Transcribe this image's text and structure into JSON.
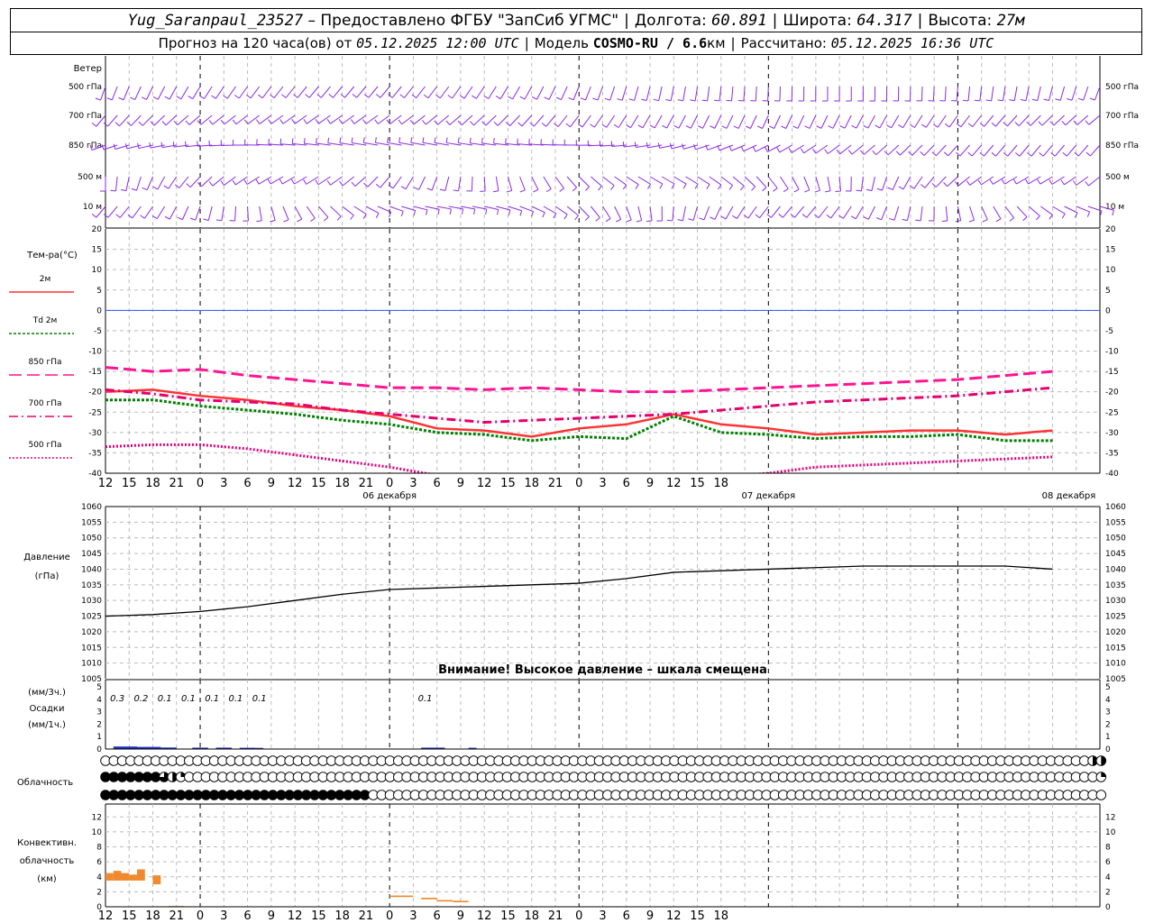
{
  "header": {
    "station": "Yug_Saranpaul_23527",
    "provider": "– Предоставлено ФГБУ \"ЗапСиб УГМС\"",
    "lon_label": "Долгота:",
    "lon": "60.891",
    "lat_label": "Широта:",
    "lat": "64.317",
    "alt_label": "Высота:",
    "alt": "27м",
    "forecast_label": "Прогноз на 120 часа(ов) от",
    "forecast_time": "05.12.2025 12:00 UTC",
    "model_label": "Модель",
    "model": "COSMO-RU / 6.6",
    "model_unit": "км",
    "calc_label": "Рассчитано:",
    "calc_time": "05.12.2025 16:36 UTC"
  },
  "colors": {
    "wind": "#8a2be2",
    "t2m": "#ff3333",
    "td2m": "#008000",
    "t850": "#ff1493",
    "t700": "#e6006e",
    "t500": "#e6007e",
    "zero": "#3050ff",
    "pressure": "#000000",
    "precip": "#2030c0",
    "conv": "#f08a30"
  },
  "wind_panel": {
    "title": "Ветер",
    "levels": [
      "500 гПа",
      "700 гПа",
      "850 гПа",
      "500 м",
      "10 м"
    ]
  },
  "temp_panel": {
    "title": "Тем-ра(°С)",
    "legend": [
      {
        "label": "2м",
        "color": "#ff3333",
        "dash": ""
      },
      {
        "label": "Td  2м",
        "color": "#008000",
        "dash": "3,2"
      },
      {
        "label": "850 гПа",
        "color": "#ff1493",
        "dash": "14,6"
      },
      {
        "label": "700 гПа",
        "color": "#e6006e",
        "dash": "10,4,2,4"
      },
      {
        "label": "500 гПа",
        "color": "#e6007e",
        "dash": "2,2"
      }
    ],
    "y_ticks": [
      "20",
      "15",
      "10",
      "5",
      "0",
      "-5",
      "-10",
      "-15",
      "-20",
      "-25",
      "-30",
      "-35",
      "-40"
    ]
  },
  "x_axis": {
    "hour_labels": [
      "12",
      "15",
      "18",
      "21",
      "0",
      "3",
      "6",
      "9",
      "12",
      "15",
      "18",
      "21",
      "0",
      "3",
      "6",
      "9",
      "12",
      "15",
      "18",
      "21",
      "0",
      "3",
      "6",
      "9",
      "12",
      "15",
      "18"
    ],
    "dates": [
      "06 декабря",
      "07 декабря",
      "08 декабря"
    ]
  },
  "pressure_panel": {
    "title": "Давление",
    "unit": "(гПа)",
    "y_ticks": [
      "1060",
      "1055",
      "1050",
      "1045",
      "1040",
      "1035",
      "1030",
      "1025",
      "1020",
      "1015",
      "1010",
      "1005"
    ],
    "warning": "Внимание! Высокое давление – шкала смещена"
  },
  "precip_panel": {
    "unit3": "(мм/3ч.)",
    "title": "Осадки",
    "unit1": "(мм/1ч.)",
    "y_ticks": [
      "5",
      "4",
      "3",
      "2",
      "1",
      "0"
    ],
    "amounts": [
      {
        "text": "0.3",
        "hour": 1.5
      },
      {
        "text": "0.2",
        "hour": 4.5
      },
      {
        "text": "0.1",
        "hour": 7.5
      },
      {
        "text": "0.1",
        "hour": 10.5
      },
      {
        "text": "0.1",
        "hour": 13.5
      },
      {
        "text": "0.1",
        "hour": 16.5
      },
      {
        "text": "0.1",
        "hour": 19.5
      },
      {
        "text": "0.1",
        "hour": 40.5
      }
    ]
  },
  "cloud_panel": {
    "title": "Облачность"
  },
  "conv_panel": {
    "title1": "Конвективн.",
    "title2": "облачность",
    "unit": "(км)",
    "y_ticks": [
      "12",
      "10",
      "8",
      "6",
      "4",
      "2",
      "0"
    ]
  },
  "chart_data": [
    {
      "type": "line",
      "title": "Тем-ра(°С)",
      "x_hours_from_start": [
        0,
        6,
        12,
        18,
        24,
        30,
        36,
        42,
        48,
        54,
        60,
        66,
        72,
        78,
        84,
        90,
        96,
        102,
        108,
        114,
        120
      ],
      "ylim": [
        -40,
        20
      ],
      "series": [
        {
          "name": "2м",
          "values": [
            -20,
            -19.5,
            -21,
            -22,
            -23.5,
            -24.5,
            -26,
            -29,
            -29.5,
            -31,
            -29,
            -28,
            -25.5,
            -28,
            -29,
            -30.5,
            -30,
            -29.5,
            -29.5,
            -30.5,
            -29.5
          ]
        },
        {
          "name": "Td  2м",
          "values": [
            -22,
            -22,
            -23.5,
            -24.5,
            -25.5,
            -27,
            -28,
            -30,
            -30.5,
            -32,
            -31,
            -31.5,
            -26,
            -30,
            -30.5,
            -31.5,
            -31,
            -31,
            -30.5,
            -32,
            -32
          ]
        },
        {
          "name": "850 гПа",
          "values": [
            -14,
            -15,
            -14.5,
            -16,
            -17,
            -18,
            -19,
            -19,
            -19.5,
            -19,
            -19.5,
            -20,
            -20,
            -19.5,
            -19,
            -18.5,
            -18,
            -17.5,
            -17,
            -16,
            -15
          ]
        },
        {
          "name": "700 гПа",
          "values": [
            -19.5,
            -20.5,
            -22,
            -22.5,
            -23,
            -24.5,
            -25.5,
            -26.5,
            -27.5,
            -27,
            -26.5,
            -26,
            -25.5,
            -24.5,
            -23.5,
            -22.5,
            -22,
            -21.5,
            -21,
            -20,
            -19
          ]
        },
        {
          "name": "500 гПа",
          "values": [
            -33.5,
            -33,
            -33,
            -34,
            -35.5,
            -37,
            -38.5,
            -40.5,
            -42,
            -42.5,
            -42.5,
            -42,
            -41.5,
            -41,
            -40,
            -38.5,
            -38,
            -37.5,
            -37,
            -36.5,
            -36
          ]
        }
      ]
    },
    {
      "type": "line",
      "title": "Давление",
      "ylabel": "(гПа)",
      "x_hours_from_start": [
        0,
        6,
        12,
        18,
        24,
        30,
        36,
        42,
        48,
        54,
        60,
        66,
        72,
        78,
        84,
        90,
        96,
        102,
        108,
        114,
        120
      ],
      "ylim": [
        1005,
        1060
      ],
      "series": [
        {
          "name": "Давление",
          "values": [
            1025,
            1025.5,
            1026.5,
            1028,
            1030,
            1032,
            1033.5,
            1034,
            1034.5,
            1035,
            1035.5,
            1037,
            1039,
            1039.5,
            1040,
            1040.5,
            1041,
            1041,
            1041,
            1041,
            1040
          ]
        }
      ]
    },
    {
      "type": "bar",
      "title": "Осадки",
      "ylabel": "(мм/1ч.)",
      "ylim": [
        0,
        5
      ],
      "bars_hour_range_mm": [
        [
          1,
          4,
          0.13
        ],
        [
          4,
          7,
          0.1
        ],
        [
          7,
          9,
          0.05
        ],
        [
          11,
          13,
          0.04
        ],
        [
          14,
          16,
          0.04
        ],
        [
          17,
          19,
          0.03
        ],
        [
          19,
          20,
          0.02
        ],
        [
          40,
          43,
          0.04
        ],
        [
          46,
          47,
          0.03
        ]
      ]
    },
    {
      "type": "bar",
      "title": "Конвективн. облачность",
      "ylabel": "(км)",
      "ylim": [
        0,
        13
      ],
      "segments_hour_start_end_top_bottom_km": [
        [
          0,
          1,
          4.5,
          3.5
        ],
        [
          1,
          2,
          4.8,
          3.5
        ],
        [
          2,
          3,
          4.5,
          3.5
        ],
        [
          3,
          4,
          4.3,
          3.5
        ],
        [
          4,
          5,
          5.0,
          3.5
        ],
        [
          6,
          7,
          4.2,
          3.0
        ],
        [
          8,
          9,
          0.1,
          0
        ],
        [
          9,
          10,
          0.1,
          0
        ],
        [
          36,
          39,
          1.5,
          1.3
        ],
        [
          40,
          42,
          1.2,
          1.0
        ],
        [
          42,
          44,
          0.9,
          0.7
        ],
        [
          44,
          46,
          0.8,
          0.6
        ]
      ]
    }
  ],
  "clouds": {
    "row1": [
      0,
      0,
      0,
      0,
      0,
      0,
      0,
      0,
      0,
      0,
      0,
      0,
      0,
      0,
      0,
      0,
      0,
      0,
      0,
      0,
      0,
      0,
      0,
      0,
      0,
      0,
      0,
      0,
      0,
      0,
      0,
      0,
      0,
      0,
      0,
      0,
      0,
      0,
      0,
      0,
      0,
      0,
      0,
      0,
      0,
      0,
      0,
      0,
      0,
      0,
      0,
      0,
      0,
      0,
      0,
      0,
      0,
      0,
      0,
      0,
      0,
      0,
      0,
      0,
      0,
      0,
      0,
      0,
      0,
      0,
      0,
      0,
      0,
      0,
      0,
      0,
      0,
      0,
      0,
      0,
      0,
      0,
      0,
      0,
      0,
      0,
      0,
      0,
      0,
      0,
      0,
      0,
      0,
      0,
      0,
      0,
      0,
      0,
      0,
      0,
      0,
      0,
      0,
      0,
      0,
      0,
      0,
      0,
      0,
      0,
      0,
      0,
      0,
      0,
      0,
      0,
      0,
      0,
      2,
      2
    ],
    "row2": [
      4,
      4,
      4,
      4,
      4,
      4,
      4,
      3,
      2,
      1,
      0,
      0,
      0,
      0,
      0,
      0,
      0,
      0,
      0,
      0,
      0,
      0,
      0,
      0,
      0,
      0,
      0,
      0,
      0,
      0,
      0,
      0,
      0,
      0,
      0,
      0,
      0,
      0,
      0,
      0,
      0,
      0,
      0,
      0,
      0,
      0,
      0,
      0,
      0,
      0,
      0,
      0,
      0,
      0,
      0,
      0,
      0,
      0,
      0,
      0,
      0,
      0,
      0,
      0,
      0,
      0,
      0,
      0,
      0,
      0,
      0,
      0,
      0,
      0,
      0,
      0,
      0,
      0,
      0,
      0,
      0,
      0,
      0,
      0,
      0,
      0,
      0,
      0,
      0,
      0,
      0,
      0,
      0,
      0,
      0,
      0,
      0,
      0,
      0,
      0,
      0,
      0,
      0,
      0,
      0,
      0,
      0,
      0,
      0,
      0,
      0,
      0,
      0,
      0,
      0,
      0,
      0,
      0,
      0,
      1
    ],
    "row3": [
      4,
      4,
      4,
      4,
      4,
      4,
      4,
      4,
      4,
      4,
      4,
      4,
      4,
      4,
      4,
      4,
      4,
      4,
      4,
      4,
      4,
      4,
      4,
      4,
      4,
      4,
      4,
      4,
      4,
      4,
      4,
      4,
      0,
      0,
      0,
      0,
      0,
      0,
      0,
      0,
      0,
      0,
      0,
      0,
      0,
      0,
      0,
      0,
      0,
      0,
      0,
      0,
      0,
      0,
      0,
      0,
      0,
      0,
      0,
      0,
      0,
      0,
      0,
      0,
      0,
      0,
      0,
      0,
      0,
      0,
      0,
      0,
      0,
      0,
      0,
      0,
      0,
      0,
      0,
      0,
      0,
      0,
      0,
      0,
      0,
      0,
      0,
      0,
      0,
      0,
      0,
      0,
      0,
      0,
      0,
      0,
      0,
      0,
      0,
      0,
      0,
      0,
      0,
      0,
      0,
      0,
      0,
      0,
      0,
      0,
      0,
      0,
      0,
      0,
      0,
      0,
      0,
      0,
      0,
      0
    ]
  }
}
